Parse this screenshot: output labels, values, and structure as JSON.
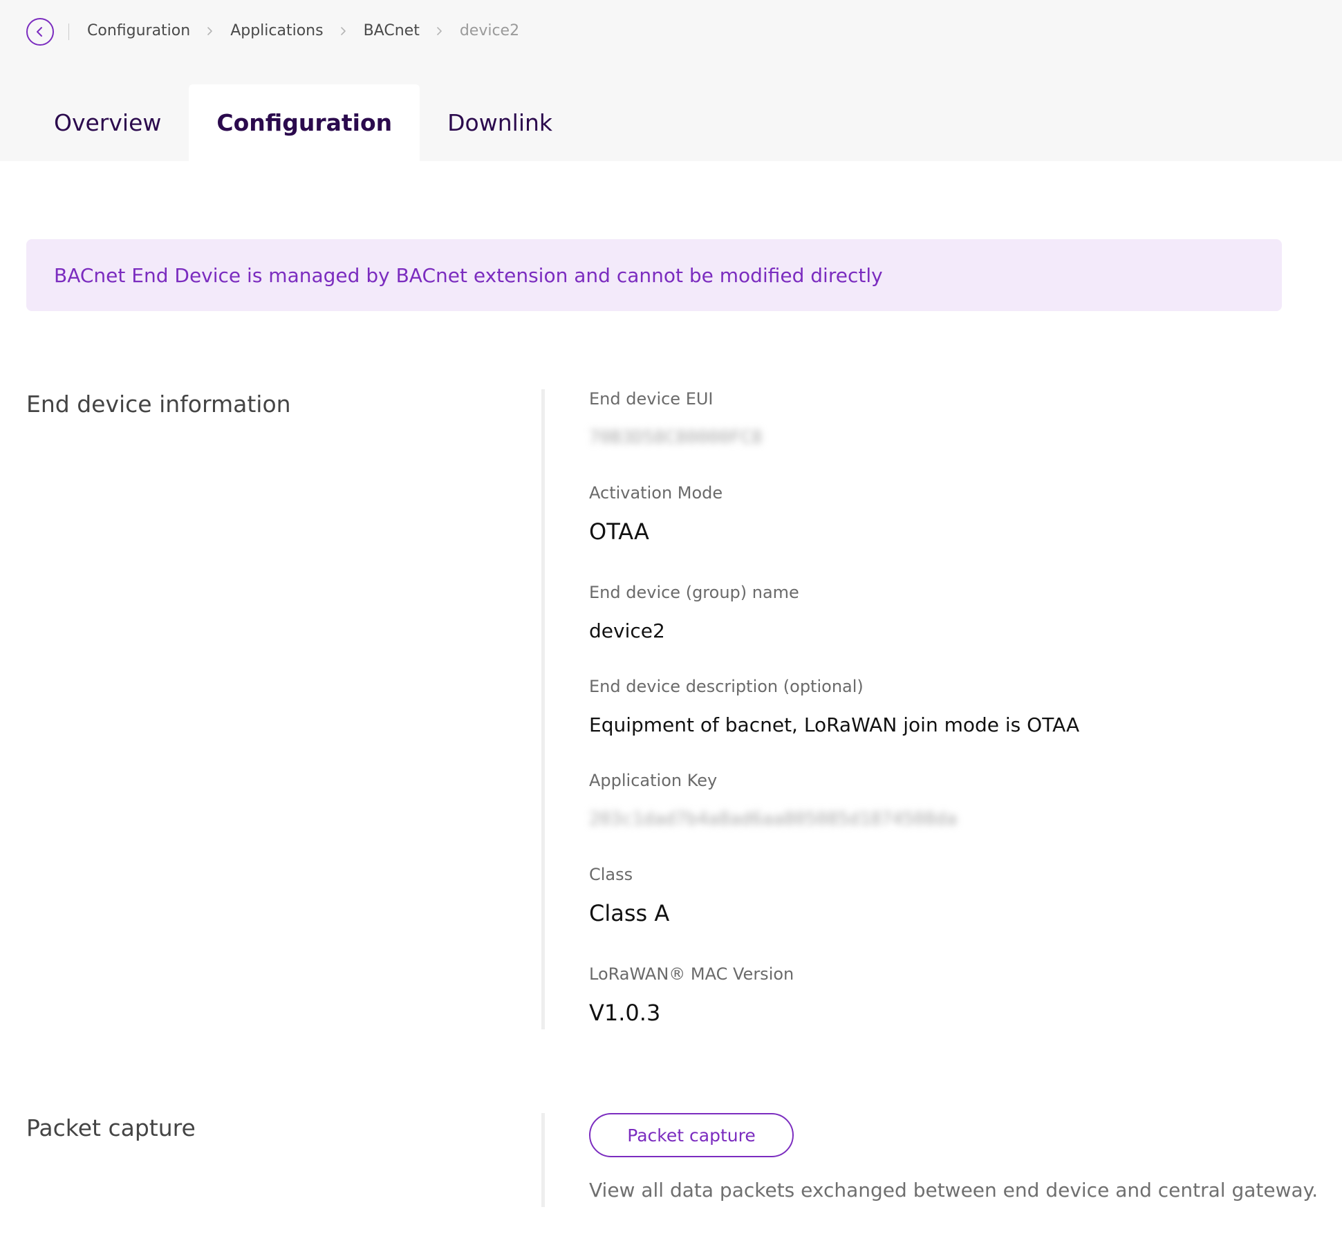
{
  "breadcrumb": {
    "items": [
      "Configuration",
      "Applications",
      "BACnet",
      "device2"
    ]
  },
  "tabs": [
    {
      "label": "Overview",
      "active": false
    },
    {
      "label": "Configuration",
      "active": true
    },
    {
      "label": "Downlink",
      "active": false
    }
  ],
  "notice": {
    "text": "BACnet End Device is managed by BACnet extension and cannot be modified directly"
  },
  "end_device_info": {
    "title": "End device information",
    "fields": [
      {
        "label": "End device EUI",
        "value": "70B3D58C80000FC8",
        "blurred": true
      },
      {
        "label": "Activation Mode",
        "value": "OTAA"
      },
      {
        "label": "End device (group) name",
        "value": "device2"
      },
      {
        "label": "End device description (optional)",
        "value": "Equipment of bacnet, LoRaWAN join mode is OTAA"
      },
      {
        "label": "Application Key",
        "value": "203c1dad7b4a8ad6aa805085d1874508da",
        "blurred": true
      },
      {
        "label": "Class",
        "value": "Class A"
      },
      {
        "label": "LoRaWAN® MAC Version",
        "value": "V1.0.3"
      }
    ]
  },
  "packet_capture": {
    "title": "Packet capture",
    "button_label": "Packet capture",
    "description": "View all data packets exchanged between end device and central gateway."
  },
  "colors": {
    "accent": "#7b2cbf",
    "notice_bg": "#f3eafa",
    "topbar_bg": "#f7f7f7",
    "tab_text": "#2b0a4d"
  },
  "icons": {
    "back": "chevron-left-icon",
    "breadcrumb_separator": "chevron-right-icon"
  }
}
